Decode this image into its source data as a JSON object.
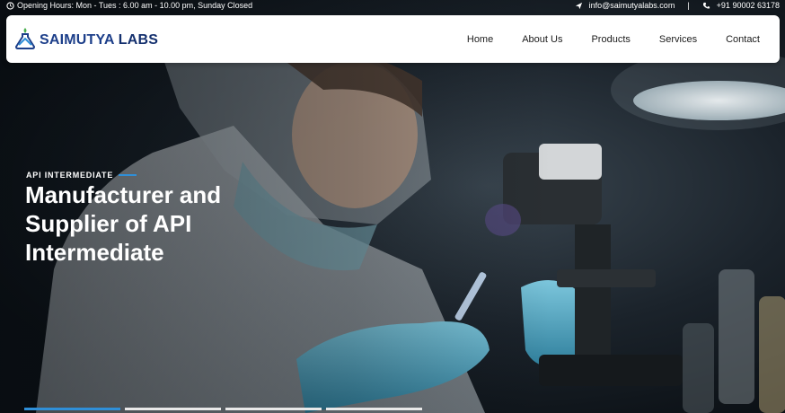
{
  "topbar": {
    "hours": "Opening Hours: Mon - Tues : 6.00 am - 10.00 pm, Sunday Closed",
    "email": "info@saimutyalabs.com",
    "separator": "|",
    "phone": "+91 90002 63178"
  },
  "brand": {
    "name_part1": "SAIMUTYA",
    "name_part2": "LABS",
    "primary_color": "#1d3f8a",
    "accent_color": "#2f8fd8"
  },
  "nav": {
    "items": [
      {
        "label": "Home"
      },
      {
        "label": "About Us"
      },
      {
        "label": "Products"
      },
      {
        "label": "Services"
      },
      {
        "label": "Contact"
      }
    ]
  },
  "hero": {
    "eyebrow": "API INTERMEDIATE",
    "headline_line1": "Manufacturer and",
    "headline_line2": "Supplier of API",
    "headline_line3": "Intermediate"
  },
  "slider": {
    "count": 4,
    "active_index": 0
  },
  "icons": {
    "clock": "clock-icon",
    "email": "paper-plane-icon",
    "phone": "phone-icon",
    "logo": "flask-logo-icon"
  }
}
